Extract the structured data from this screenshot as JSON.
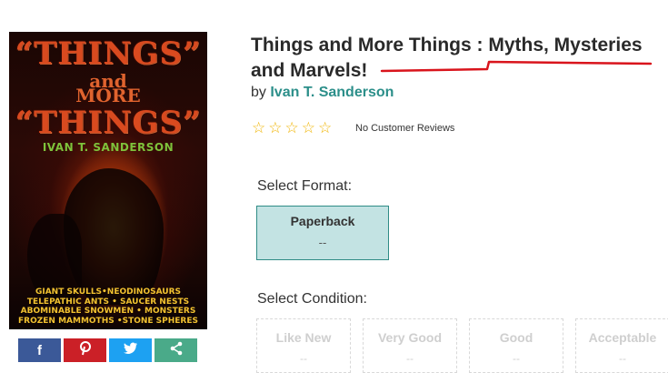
{
  "book": {
    "title": "Things and More Things : Myths, Mysteries and Marvels!",
    "by_label": "by",
    "author": "Ivan T. Sanderson"
  },
  "cover": {
    "line1": "“THINGS”",
    "line2": "and",
    "line3": "MORE",
    "line4": "“THINGS”",
    "author": "IVAN T. SANDERSON",
    "blurb": [
      "GIANT SKULLS•NEODINOSAURS",
      "TELEPATHIC ANTS • SAUCER NESTS",
      "ABOMINABLE SNOWMEN • MONSTERS",
      "FROZEN MAMMOTHS •STONE SPHERES"
    ]
  },
  "rating": {
    "stars_filled": 0,
    "stars_total": 5,
    "reviews_text": "No Customer Reviews"
  },
  "share": {
    "facebook": "f",
    "pinterest": "P",
    "twitter": "t",
    "share": "<"
  },
  "format": {
    "label": "Select Format:",
    "options": [
      {
        "name": "Paperback",
        "price": "--",
        "selected": true
      }
    ]
  },
  "condition": {
    "label": "Select Condition:",
    "options": [
      {
        "name": "Like New",
        "price": "--"
      },
      {
        "name": "Very Good",
        "price": "--"
      },
      {
        "name": "Good",
        "price": "--"
      },
      {
        "name": "Acceptable",
        "price": "--"
      }
    ]
  },
  "colors": {
    "accent": "#2c8f8a",
    "selected_bg": "#c3e3e3",
    "star": "#f0b400",
    "annotation_underline": "#d9141c"
  }
}
